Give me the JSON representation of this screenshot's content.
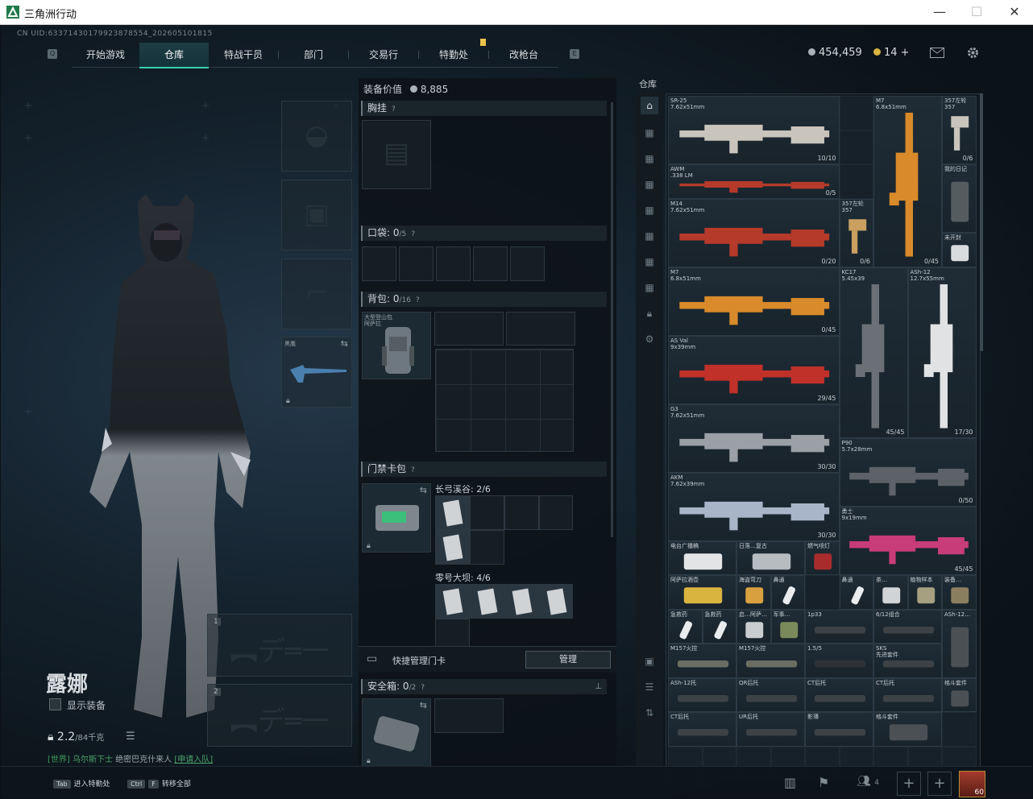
{
  "window": {
    "title": "三角洲行动",
    "controls": [
      "minimize-icon",
      "maximize-icon",
      "close-icon"
    ]
  },
  "uid": "CN UID:633714301799238785​54_2026051018​15",
  "nav": {
    "tabs": [
      "开始游戏",
      "仓库",
      "特战干员",
      "部门",
      "交易行",
      "特勤处",
      "改枪台"
    ],
    "active": "仓库"
  },
  "currency": {
    "money": "454,459",
    "coins": "14 +"
  },
  "character": {
    "name": "露娜",
    "show_equipment_label": "显示装备",
    "weight": "2.2",
    "weight_max": "/84千克",
    "melee_label": "黑鹰",
    "weapon_slot_1": "1",
    "weapon_slot_2": "2",
    "chat_channel": "[世界]",
    "chat_user": "乌尔斯下士",
    "chat_message": "绝密巴克什来人",
    "chat_link": "[申请入队]"
  },
  "equipment_panel": {
    "value_label": "装备价值",
    "value": "8,885",
    "chest_rig": "胸挂",
    "pocket_label": "口袋:",
    "pocket_count": "0",
    "pocket_cap": "/5",
    "backpack_label": "背包:",
    "backpack_count": "0",
    "backpack_cap": "/16",
    "backpack_item": "大型登山包\n阿萨拉",
    "keycard_label": "门禁卡包",
    "keycard_map1": "长弓溪谷: 2/6",
    "keycard_map2": "零号大坝: 4/6",
    "quick_manage": "快捷管理门卡",
    "manage_button": "管理",
    "safebox_label": "安全箱:",
    "safebox_count": "0",
    "safebox_cap": "/2"
  },
  "warehouse": {
    "title": "仓库",
    "items": [
      {
        "name": "SR-25\n7.62x51mm",
        "count": "10/10"
      },
      {
        "name": "M7\n6.8x51mm",
        "count": "0/45"
      },
      {
        "name": "357左轮\n357",
        "count": "0/6"
      },
      {
        "name": "AWM\n.338 LM",
        "count": "0/5"
      },
      {
        "name": "我的日记",
        "count": ""
      },
      {
        "name": "M14\n7.62x51mm",
        "count": "0/20"
      },
      {
        "name": "357左轮\n357",
        "count": "0/6"
      },
      {
        "name": "未开封",
        "count": ""
      },
      {
        "name": "M7\n6.8x51mm",
        "count": "0/45"
      },
      {
        "name": "KC17\n5.45x39",
        "count": "45/45"
      },
      {
        "name": "ASh-12\n12.7x55mm",
        "count": "17/30"
      },
      {
        "name": "AS Val\n9x39mm",
        "count": "29/45"
      },
      {
        "name": "G3\n7.62x51mm",
        "count": "30/30"
      },
      {
        "name": "P90\n5.7x28mm",
        "count": "0/50"
      },
      {
        "name": "AKM\n7.62x39mm",
        "count": "30/30"
      },
      {
        "name": "勇士\n9x19mm",
        "count": "45/45"
      },
      {
        "name": "电台广播稿",
        "count": ""
      },
      {
        "name": "日落…复古",
        "count": ""
      },
      {
        "name": "燃气喷灯",
        "count": ""
      },
      {
        "name": "阿萨拉酒壶",
        "count": ""
      },
      {
        "name": "海盗弯刀",
        "count": ""
      },
      {
        "name": "鼻通",
        "count": ""
      },
      {
        "name": "鼻通",
        "count": ""
      },
      {
        "name": "茶…",
        "count": ""
      },
      {
        "name": "植物样本",
        "count": ""
      },
      {
        "name": "装备…",
        "count": ""
      },
      {
        "name": "急救药",
        "count": ""
      },
      {
        "name": "急救药",
        "count": ""
      },
      {
        "name": "启…阿萨…",
        "count": ""
      },
      {
        "name": "军事…",
        "count": ""
      },
      {
        "name": "1p33",
        "count": ""
      },
      {
        "name": "6/12组合",
        "count": ""
      },
      {
        "name": "ASh-12…",
        "count": ""
      },
      {
        "name": "M157火控",
        "count": ""
      },
      {
        "name": "M157火控",
        "count": ""
      },
      {
        "name": "1.5/5",
        "count": ""
      },
      {
        "name": "SKS\n先进套件",
        "count": ""
      },
      {
        "name": "ASh-12托",
        "count": ""
      },
      {
        "name": "QR后托",
        "count": ""
      },
      {
        "name": "CT后托",
        "count": ""
      },
      {
        "name": "CT后托",
        "count": ""
      },
      {
        "name": "格斗套件",
        "count": ""
      },
      {
        "name": "CT后托",
        "count": ""
      },
      {
        "name": "UR后托",
        "count": ""
      },
      {
        "name": "影薄",
        "count": ""
      },
      {
        "name": "格斗套件",
        "count": ""
      }
    ]
  },
  "bottom": {
    "key1": "Tab",
    "action1": "进入特勤处",
    "key2": "Ctrl",
    "key3": "F",
    "action2": "转移全部",
    "friends": "4",
    "level": "60"
  }
}
